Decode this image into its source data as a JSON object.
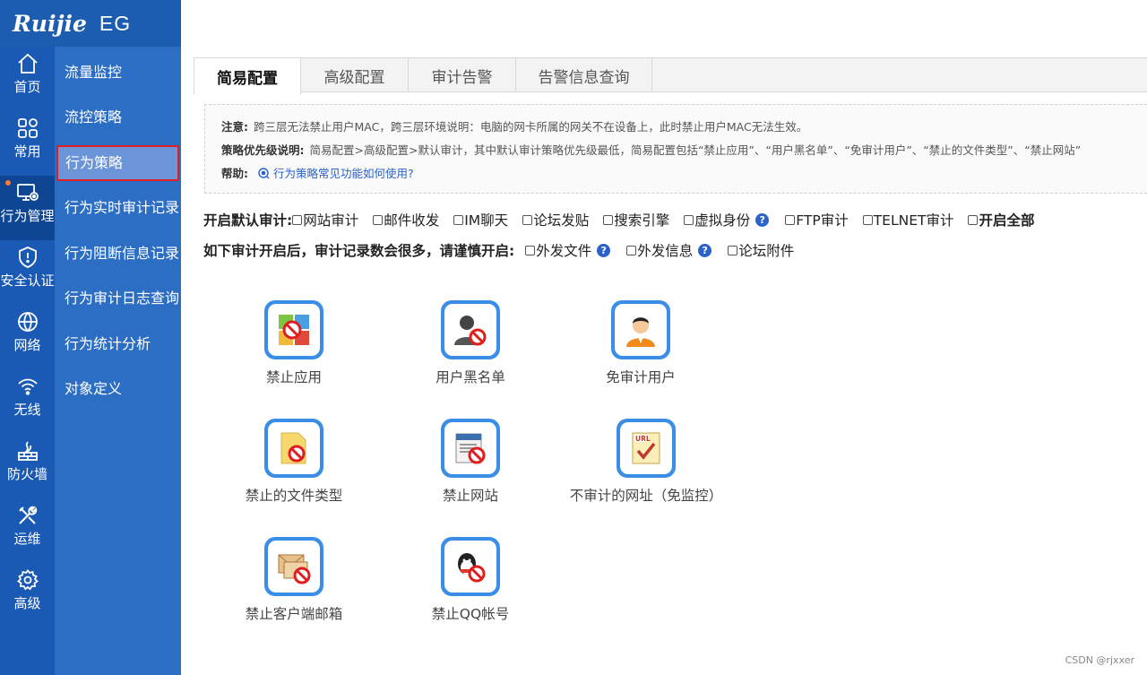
{
  "logo": {
    "brand": "Ruijie",
    "model": "EG"
  },
  "rail": [
    {
      "label": "首页",
      "icon": "home-icon"
    },
    {
      "label": "常用",
      "icon": "grid-icon"
    },
    {
      "label": "行为管理",
      "icon": "monitor-gear-icon",
      "active": true
    },
    {
      "label": "安全认证",
      "icon": "shield-icon"
    },
    {
      "label": "网络",
      "icon": "globe-icon"
    },
    {
      "label": "无线",
      "icon": "wifi-icon"
    },
    {
      "label": "防火墙",
      "icon": "firewall-icon"
    },
    {
      "label": "运维",
      "icon": "tools-icon"
    },
    {
      "label": "高级",
      "icon": "gear-icon"
    }
  ],
  "subnav": [
    {
      "label": "流量监控"
    },
    {
      "label": "流控策略"
    },
    {
      "label": "行为策略",
      "active": true
    },
    {
      "label": "行为实时审计记录"
    },
    {
      "label": "行为阻断信息记录"
    },
    {
      "label": "行为审计日志查询"
    },
    {
      "label": "行为统计分析"
    },
    {
      "label": "对象定义"
    }
  ],
  "tabs": [
    {
      "label": "简易配置",
      "active": true
    },
    {
      "label": "高级配置"
    },
    {
      "label": "审计告警"
    },
    {
      "label": "告警信息查询"
    }
  ],
  "notice": {
    "note_key": "注意:",
    "note_text": "跨三层无法禁止用户MAC，跨三层环境说明：电脑的网卡所属的网关不在设备上，此时禁止用户MAC无法生效。",
    "priority_key": "策略优先级说明:",
    "priority_text": "简易配置>高级配置>默认审计，其中默认审计策略优先级最低，简易配置包括“禁止应用”、“用户黑名单”、“免审计用户”、“禁止的文件类型”、“禁止网站”",
    "help_key": "帮助:",
    "help_link": "行为策略常见功能如何使用?"
  },
  "audit_row1": {
    "label": "开启默认审计:",
    "items": [
      "网站审计",
      "邮件收发",
      "IM聊天",
      "论坛发贴",
      "搜索引擎",
      "虚拟身份",
      "FTP审计",
      "TELNET审计",
      "开启全部"
    ],
    "help_after": "虚拟身份"
  },
  "audit_row2": {
    "label": "如下审计开启后，审计记录数会很多，请谨慎开启:",
    "items": [
      "外发文件",
      "外发信息",
      "论坛附件"
    ]
  },
  "tiles": [
    {
      "label": "禁止应用",
      "icon": "block-app-icon"
    },
    {
      "label": "用户黑名单",
      "icon": "user-blacklist-icon"
    },
    {
      "label": "免审计用户",
      "icon": "audit-exempt-user-icon"
    },
    {
      "label": "禁止的文件类型",
      "icon": "block-filetype-icon"
    },
    {
      "label": "禁止网站",
      "icon": "block-website-icon"
    },
    {
      "label": "不审计的网址（免监控）",
      "icon": "url-exempt-icon"
    },
    {
      "label": "禁止客户端邮箱",
      "icon": "block-mail-client-icon"
    },
    {
      "label": "禁止QQ帐号",
      "icon": "block-qq-icon"
    }
  ],
  "watermark": "CSDN @rjxxer",
  "colors": {
    "logo_bg": "#1d5db0",
    "rail_bg": "#1b5ab4",
    "subnav_bg": "#2c6ec4",
    "tile_frame": "#3a8ee6",
    "highlight_border": "#e02020"
  }
}
